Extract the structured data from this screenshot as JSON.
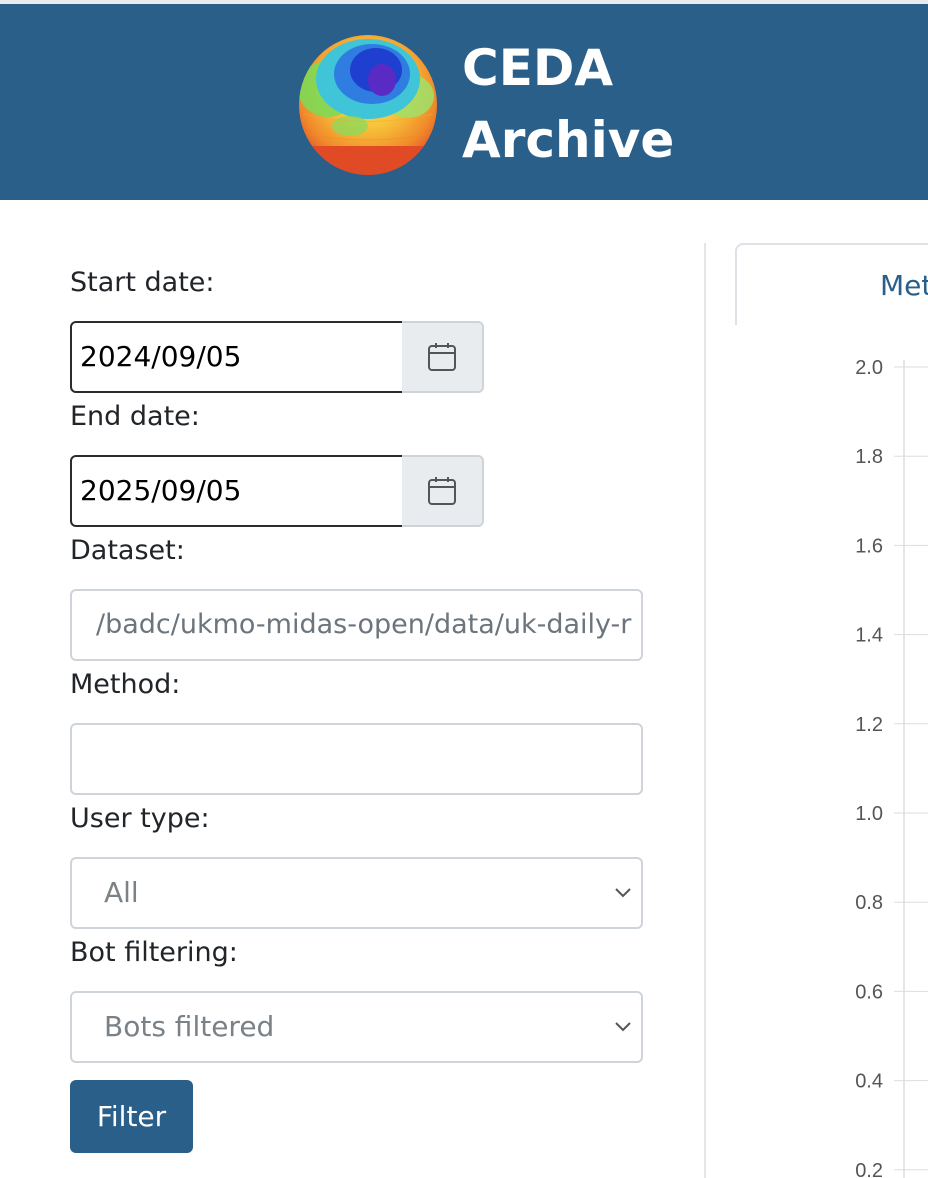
{
  "header": {
    "logo_line1": "CEDA",
    "logo_line2": "Archive",
    "background_color": "#2a5f8a"
  },
  "form": {
    "start_date": {
      "label": "Start date:",
      "value": "2024/09/05",
      "icon": "calendar-icon"
    },
    "end_date": {
      "label": "End date:",
      "value": "2025/09/05",
      "icon": "calendar-icon"
    },
    "dataset": {
      "label": "Dataset:",
      "placeholder": "/badc/ukmo-midas-open/data/uk-daily-r"
    },
    "method": {
      "label": "Method:",
      "value": ""
    },
    "user_type": {
      "label": "User type:",
      "selected": "All",
      "icon": "chevron-down-icon"
    },
    "bot_filtering": {
      "label": "Bot filtering:",
      "selected": "Bots filtered",
      "icon": "chevron-down-icon"
    },
    "filter_button": "Filter"
  },
  "tabs": [
    {
      "label": "Met"
    }
  ],
  "chart_data": {
    "type": "line",
    "ylim": [
      0.2,
      2.0
    ],
    "y_ticks": [
      "2.0",
      "1.8",
      "1.6",
      "1.4",
      "1.2",
      "1.0",
      "0.8",
      "0.6",
      "0.4",
      "0.2"
    ],
    "grid": true
  },
  "colors": {
    "accent": "#2a5f8a",
    "border": "#ced4da",
    "input_addon": "#e9ecef"
  }
}
